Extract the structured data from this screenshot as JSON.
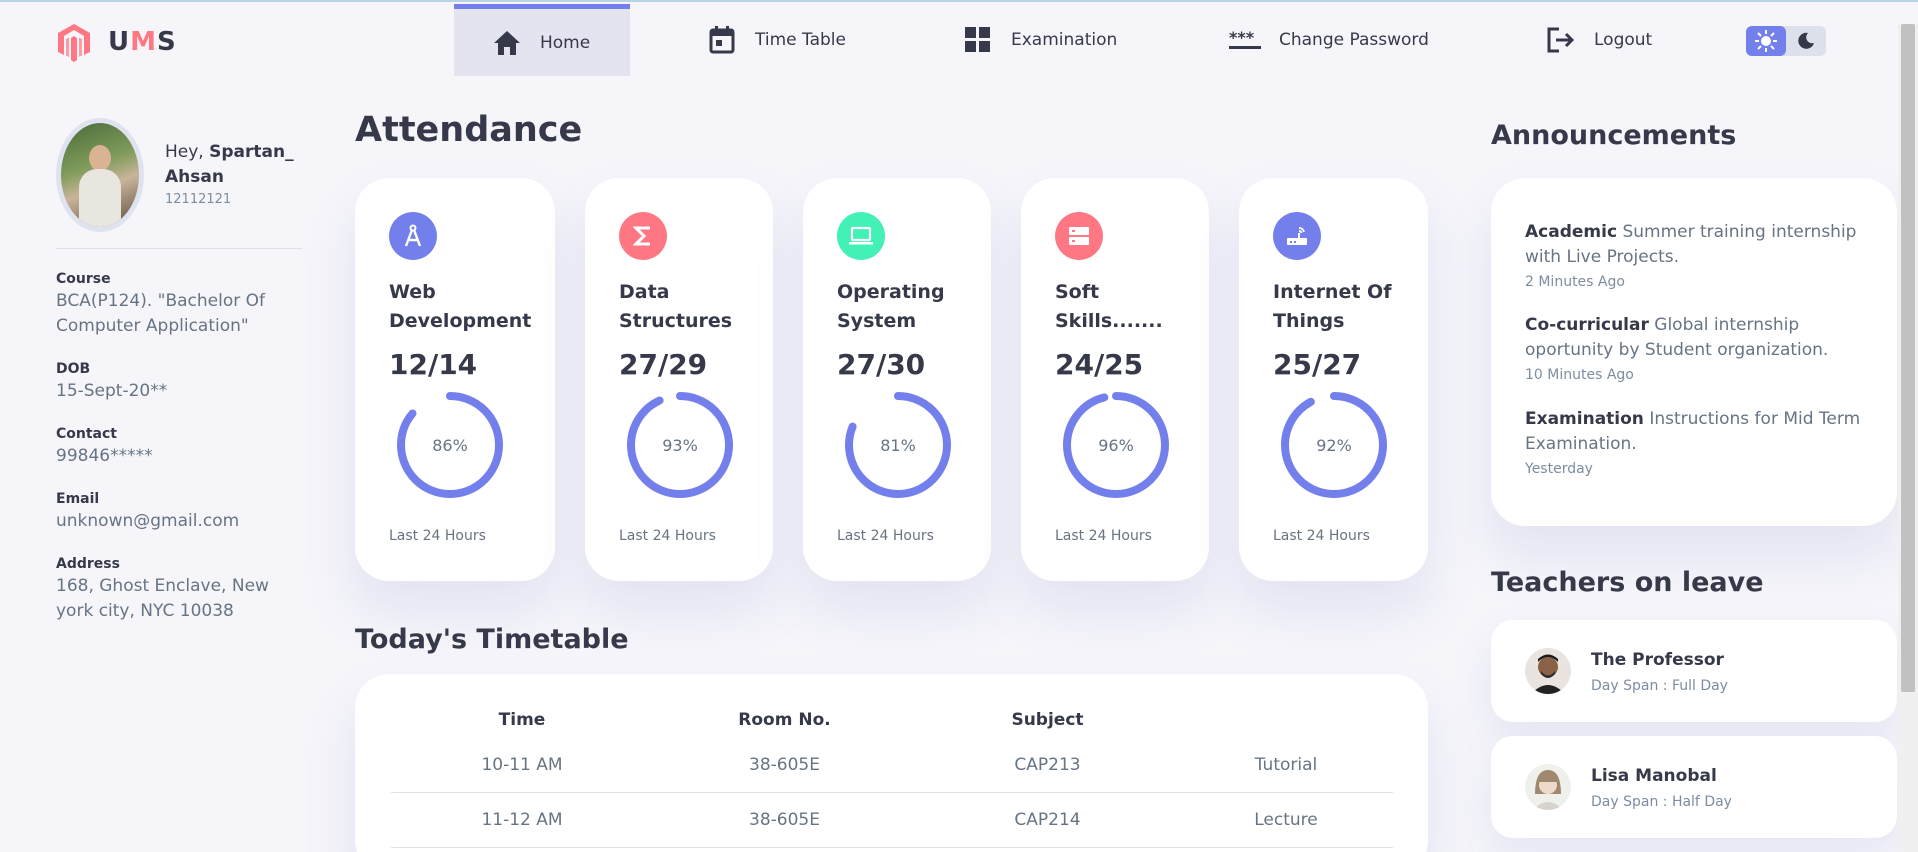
{
  "brand": {
    "u": "U",
    "m": "M",
    "s": "S",
    "accent": "#ff7782"
  },
  "nav": [
    {
      "label": "Home",
      "icon": "home-icon",
      "active": true
    },
    {
      "label": "Time Table",
      "icon": "calendar-icon"
    },
    {
      "label": "Examination",
      "icon": "grid-icon"
    },
    {
      "label": "Change Password",
      "icon": "password-icon"
    },
    {
      "label": "Logout",
      "icon": "logout-icon"
    }
  ],
  "theme": {
    "light_icon": "sun-icon",
    "dark_icon": "moon-icon",
    "accent": "#7380ec"
  },
  "profile": {
    "greeting": "Hey,",
    "name_line1": "Spartan_",
    "name_line2": "Ahsan",
    "reg_no": "12112121",
    "course_label": "Course",
    "course_value": "BCA(P124). \"Bachelor Of Computer Application\"",
    "dob_label": "DOB",
    "dob_value": "15-Sept-20**",
    "contact_label": "Contact",
    "contact_value": "99846*****",
    "email_label": "Email",
    "email_value": "unknown@gmail.com",
    "address_label": "Address",
    "address_value": "168, Ghost Enclave, New york city, NYC 10038"
  },
  "attendance": {
    "heading": "Attendance",
    "cards": [
      {
        "title": "Web Development",
        "fraction": "12/14",
        "percent": "86%",
        "ratio": 0.86,
        "footer": "Last 24 Hours",
        "icon": "compass-icon",
        "color": "#7380ec"
      },
      {
        "title": "Data Structures",
        "fraction": "27/29",
        "percent": "93%",
        "ratio": 0.93,
        "footer": "Last 24 Hours",
        "icon": "sigma-icon",
        "color": "#ff7782"
      },
      {
        "title": "Operating System",
        "fraction": "27/30",
        "percent": "81%",
        "ratio": 0.81,
        "footer": "Last 24 Hours",
        "icon": "laptop-icon",
        "color": "#41f1b6"
      },
      {
        "title": "Soft Skills.......",
        "fraction": "24/25",
        "percent": "96%",
        "ratio": 0.96,
        "footer": "Last 24 Hours",
        "icon": "server-icon",
        "color": "#ff7782"
      },
      {
        "title": "Internet Of Things",
        "fraction": "25/27",
        "percent": "92%",
        "ratio": 0.92,
        "footer": "Last 24 Hours",
        "icon": "router-icon",
        "color": "#7380ec"
      }
    ]
  },
  "timetable": {
    "heading": "Today's Timetable",
    "headers": [
      "Time",
      "Room No.",
      "Subject",
      ""
    ],
    "rows": [
      [
        "10-11 AM",
        "38-605E",
        "CAP213",
        "Tutorial"
      ],
      [
        "11-12 AM",
        "38-605E",
        "CAP214",
        "Lecture"
      ]
    ]
  },
  "announcements": {
    "heading": "Announcements",
    "items": [
      {
        "category": "Academic",
        "text": "Summer training internship with Live Projects.",
        "time": "2 Minutes Ago"
      },
      {
        "category": "Co-curricular",
        "text": "Global internship oportunity by Student organization.",
        "time": "10 Minutes Ago"
      },
      {
        "category": "Examination",
        "text": "Instructions for Mid Term Examination.",
        "time": "Yesterday"
      }
    ]
  },
  "leave": {
    "heading": "Teachers on leave",
    "items": [
      {
        "name": "The Professor",
        "span": "Day Span : Full Day"
      },
      {
        "name": "Lisa Manobal",
        "span": "Day Span : Half Day"
      }
    ]
  }
}
